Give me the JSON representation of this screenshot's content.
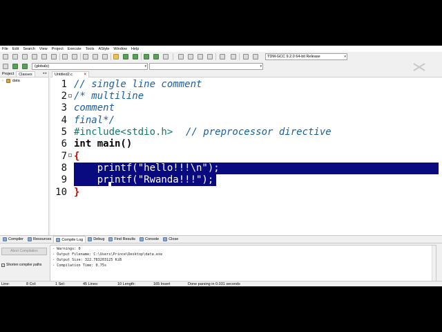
{
  "menu": [
    "File",
    "Edit",
    "Search",
    "View",
    "Project",
    "Execute",
    "Tools",
    "AStyle",
    "Window",
    "Help"
  ],
  "toolbar": {
    "compiler": "TDM-GCC 9.2.0 64-bit Release",
    "scope": "(globals)"
  },
  "leftpane": {
    "tabs": [
      "Project",
      "Classes"
    ],
    "tree": [
      {
        "label": "data"
      }
    ]
  },
  "editor": {
    "tab_label": "Untitled2.c",
    "line_numbers": [
      "1",
      "2",
      "3",
      "4",
      "5",
      "6",
      "7",
      "8",
      "9",
      "10"
    ],
    "lines": [
      "// single line comment",
      "/* multiline",
      "comment",
      "final*/",
      "#include<stdio.h>",
      "int main()",
      "{",
      "    printf(\"hello!!!\\n\");",
      "    printf(\"Rwanda!!!\");",
      "}"
    ],
    "pp_comment": "// preprocessor directive",
    "selected_lines": [
      8,
      9
    ]
  },
  "bottom": {
    "tabs": [
      "Compiler",
      "Resources",
      "Compile Log",
      "Debug",
      "Find Results",
      "Console",
      "Close"
    ],
    "active_tab": "Compile Log",
    "abort_button": "Abort Compilation",
    "shorten_label": "Shorten compiler paths",
    "log": [
      "- Warnings: 0",
      "- Output Filename: C:\\Users\\Prince\\Desktop\\data.exe",
      "- Output Size: 322.783203125 KiB",
      "- Compilation Time: 0.75s"
    ]
  },
  "status": {
    "line": "Line:",
    "col": "8 Col:",
    "sel": "1 Sel:",
    "lines": "45 Lines:",
    "length": "10 Length:",
    "insert": "165 Insert",
    "message": "Done parsing in 0.031 seconds"
  }
}
